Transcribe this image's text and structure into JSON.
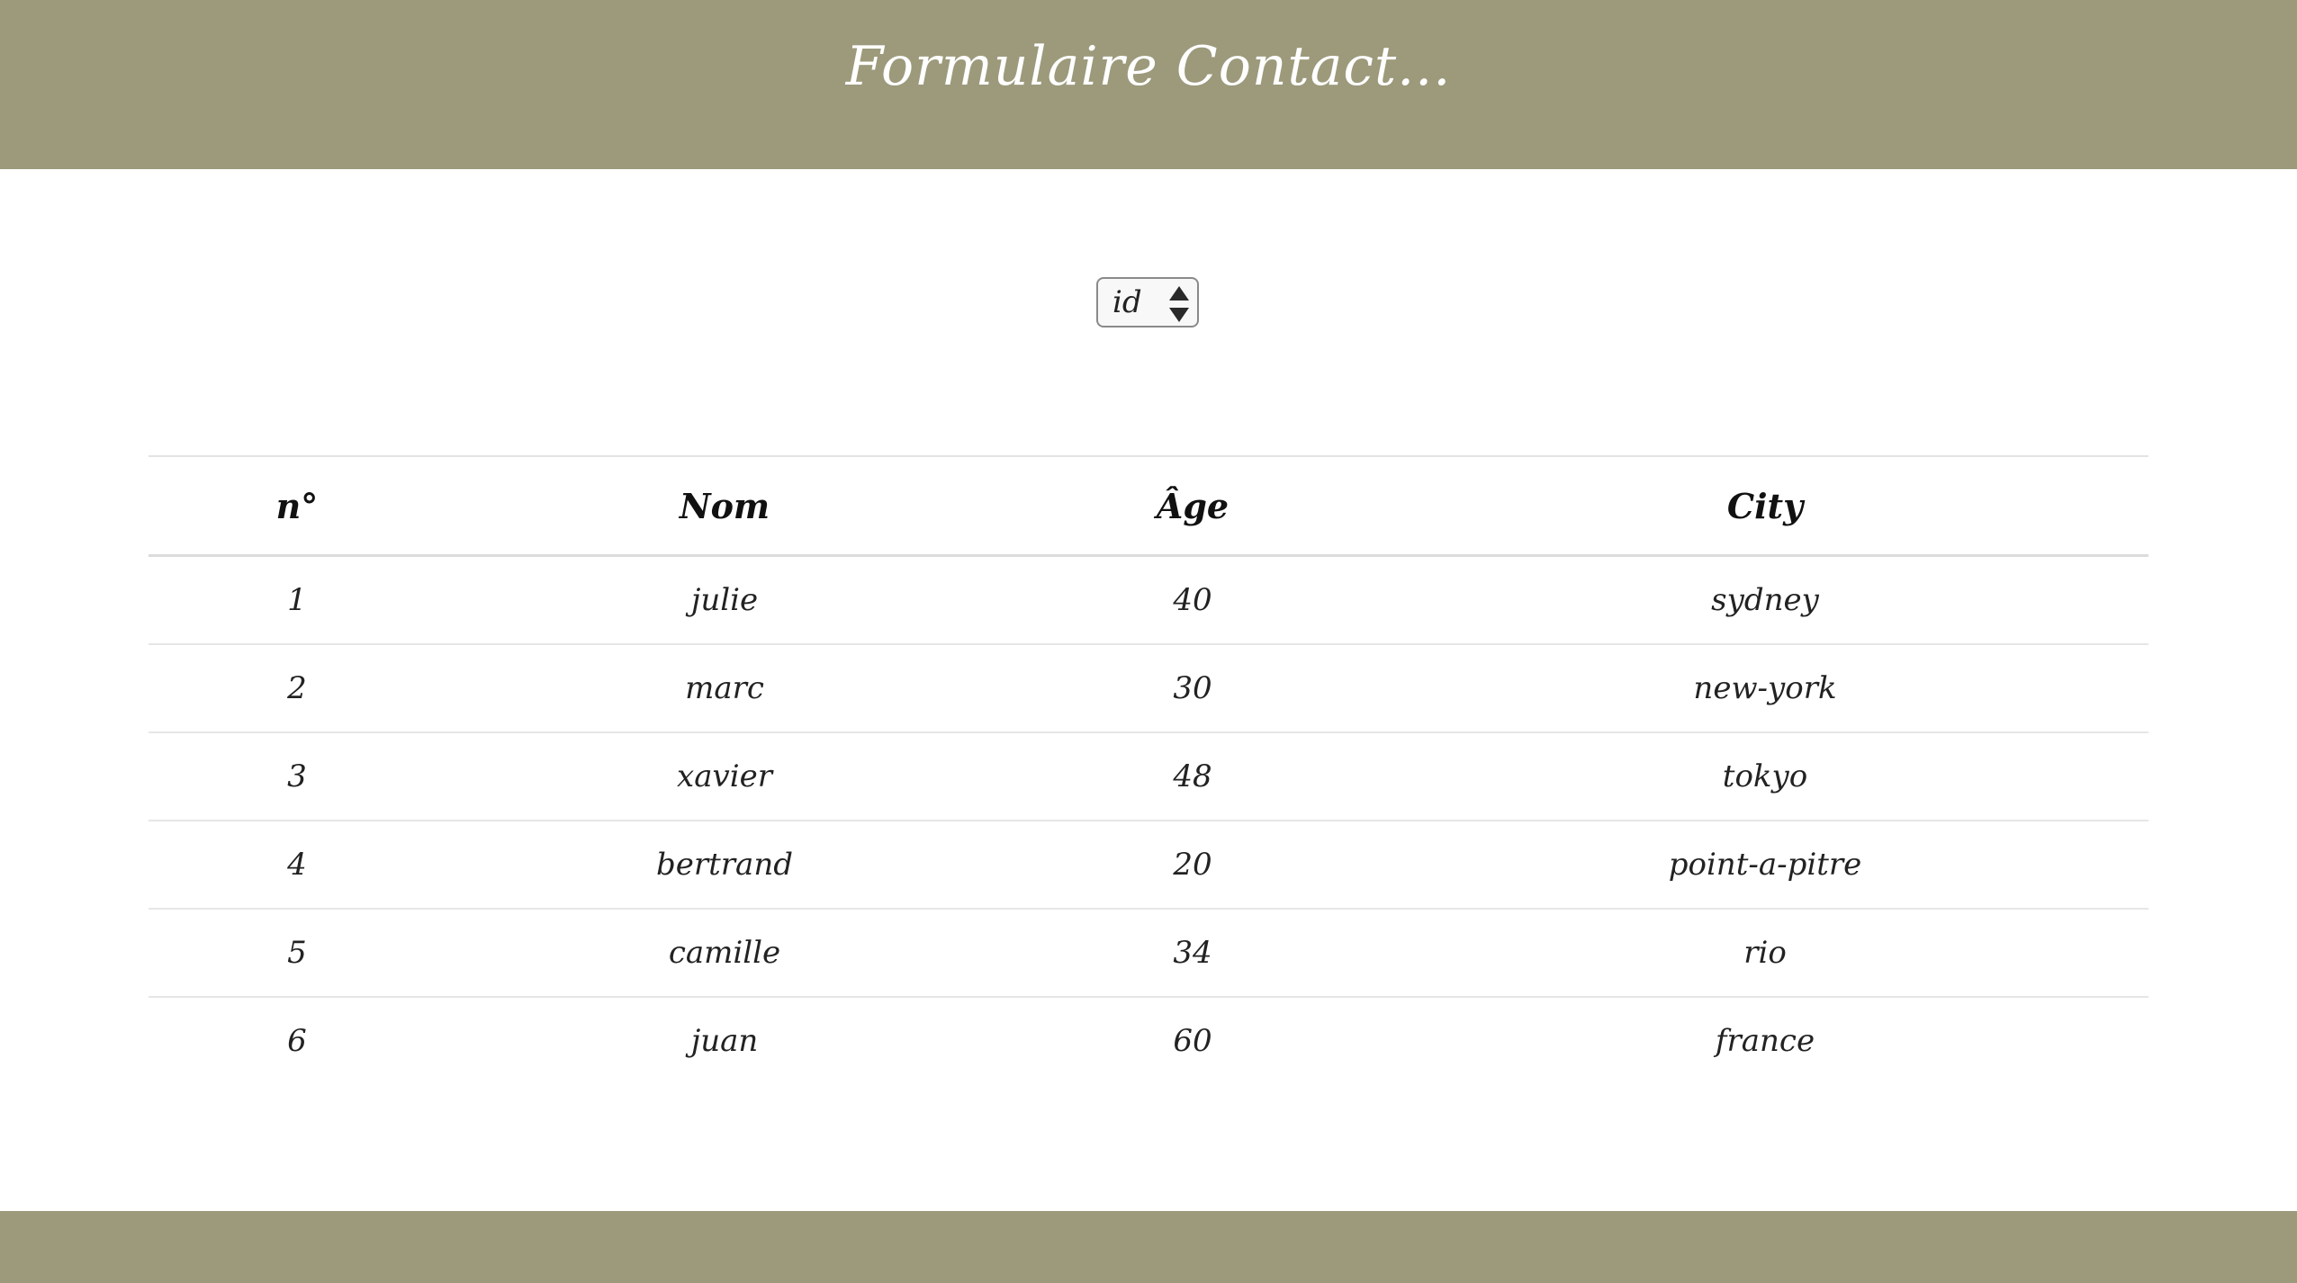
{
  "header": {
    "title": "Formulaire Contact..."
  },
  "sort_select": {
    "selected": "id"
  },
  "table": {
    "columns": [
      "n°",
      "Nom",
      "Âge",
      "City"
    ],
    "rows": [
      {
        "num": "1",
        "nom": "julie",
        "age": "40",
        "city": "sydney"
      },
      {
        "num": "2",
        "nom": "marc",
        "age": "30",
        "city": "new-york"
      },
      {
        "num": "3",
        "nom": "xavier",
        "age": "48",
        "city": "tokyo"
      },
      {
        "num": "4",
        "nom": "bertrand",
        "age": "20",
        "city": "point-a-pitre"
      },
      {
        "num": "5",
        "nom": "camille",
        "age": "34",
        "city": "rio"
      },
      {
        "num": "6",
        "nom": "juan",
        "age": "60",
        "city": "france"
      }
    ]
  },
  "colors": {
    "header_bg": "#9c9a7b",
    "footer_bg": "#9c9a7b",
    "header_text": "#ffffff"
  },
  "icons": {
    "select_arrows": "up-down-arrows-icon"
  }
}
